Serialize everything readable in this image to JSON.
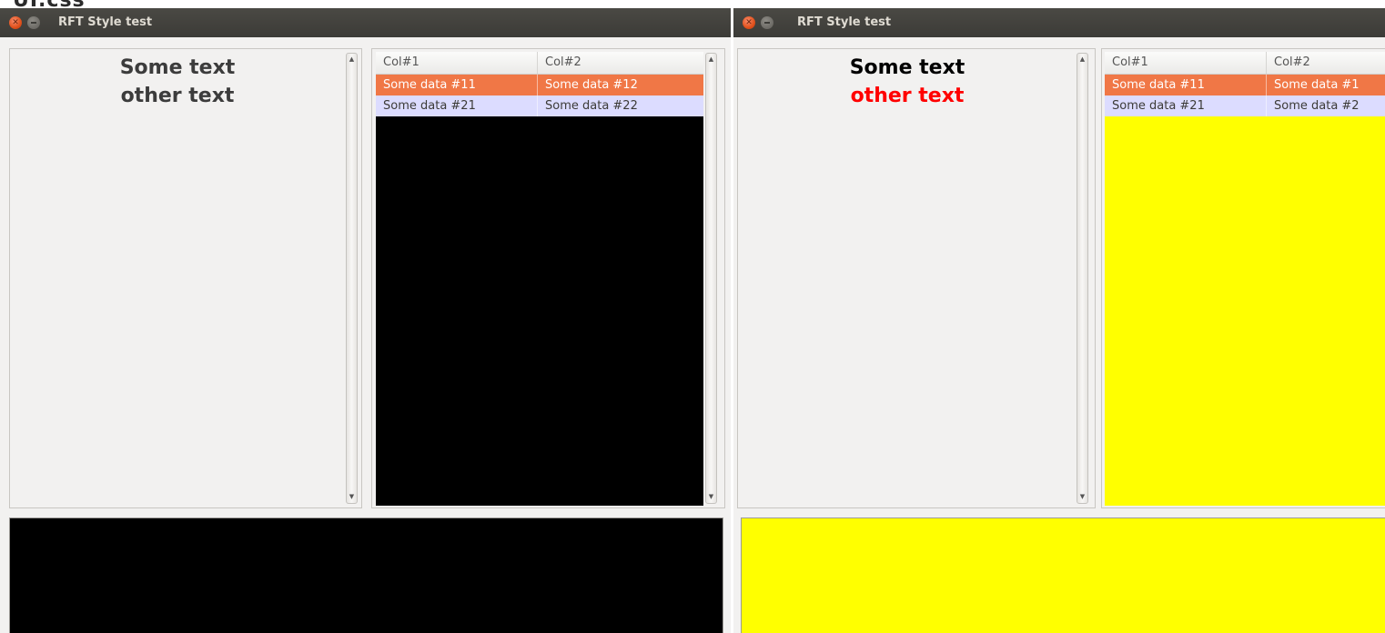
{
  "cropped_caption": "UI.css",
  "windows": [
    {
      "title": "RFT Style test",
      "label_line1": "Some text",
      "label_line2": "other text",
      "label_line1_color": "#3c3c3c",
      "label_line2_color": "#3c3c3c",
      "table": {
        "columns": [
          "Col#1",
          "Col#2"
        ],
        "rows": [
          [
            "Some data #11",
            "Some data #12"
          ],
          [
            "Some data #21",
            "Some data #22"
          ]
        ],
        "background": "#000000"
      },
      "bottom_panel_color": "#000000"
    },
    {
      "title": "RFT Style test",
      "label_line1": "Some text",
      "label_line2": "other text",
      "label_line1_color": "#000000",
      "label_line2_color": "#ff0000",
      "table": {
        "columns": [
          "Col#1",
          "Col#2"
        ],
        "rows": [
          [
            "Some data #11",
            "Some data #1"
          ],
          [
            "Some data #21",
            "Some data #2"
          ]
        ],
        "background": "#ffff00"
      },
      "bottom_panel_color": "#ffff00"
    }
  ],
  "colors": {
    "selected_row": "#f07746",
    "alt_row": "#dcdcff",
    "titlebar": "#3c3b37",
    "window_bg": "#f2f1f0"
  },
  "icons": {
    "close": "close-icon",
    "minimize": "minimize-icon",
    "scroll_up": "arrow-up-icon",
    "scroll_down": "arrow-down-icon"
  }
}
